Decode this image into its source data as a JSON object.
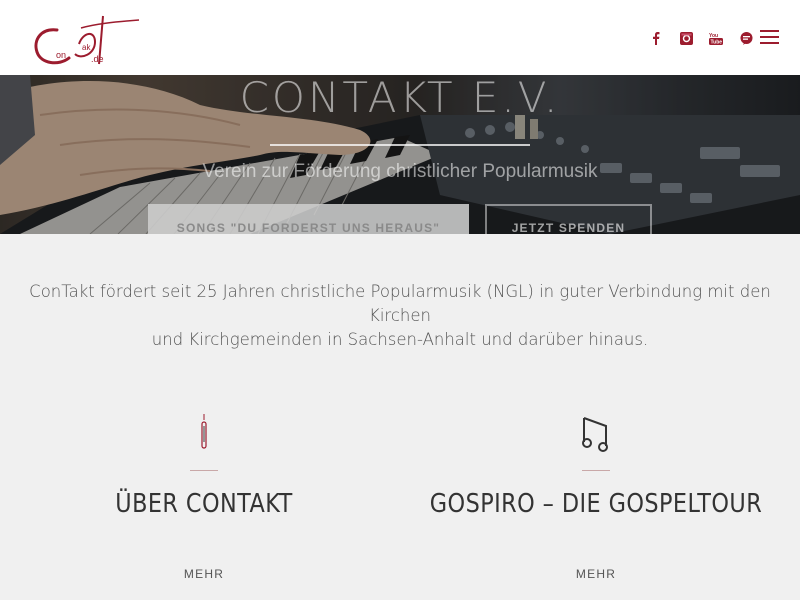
{
  "header": {
    "logo_alt": "ConTakt.de",
    "social_icons": [
      "facebook-icon",
      "instagram-icon",
      "youtube-icon",
      "chat-bubble-icon"
    ],
    "menu_icon": "hamburger-menu-icon",
    "accent_color": "#9c1c2e"
  },
  "hero": {
    "title": "CONTAKT E.V.",
    "subtitle": "Verein zur Förderung christlicher Popularmusik",
    "btn_songs": "SONGS \"DU FORDERST UNS HERAUS\"",
    "btn_spenden": "JETZT SPENDEN"
  },
  "intro": {
    "line1": "ConTakt fördert seit 25 Jahren christliche Popularmusik (NGL) in guter Verbindung mit den Kirchen",
    "line2": "und Kirchgemeinden in Sachsen-Anhalt und darüber hinaus."
  },
  "columns": [
    {
      "icon": "candle-icon",
      "title": "ÜBER CONTAKT",
      "more": "MEHR"
    },
    {
      "icon": "music-note-icon",
      "title": "GOSPIRO – DIE GOSPELTOUR",
      "more": "MEHR"
    }
  ]
}
